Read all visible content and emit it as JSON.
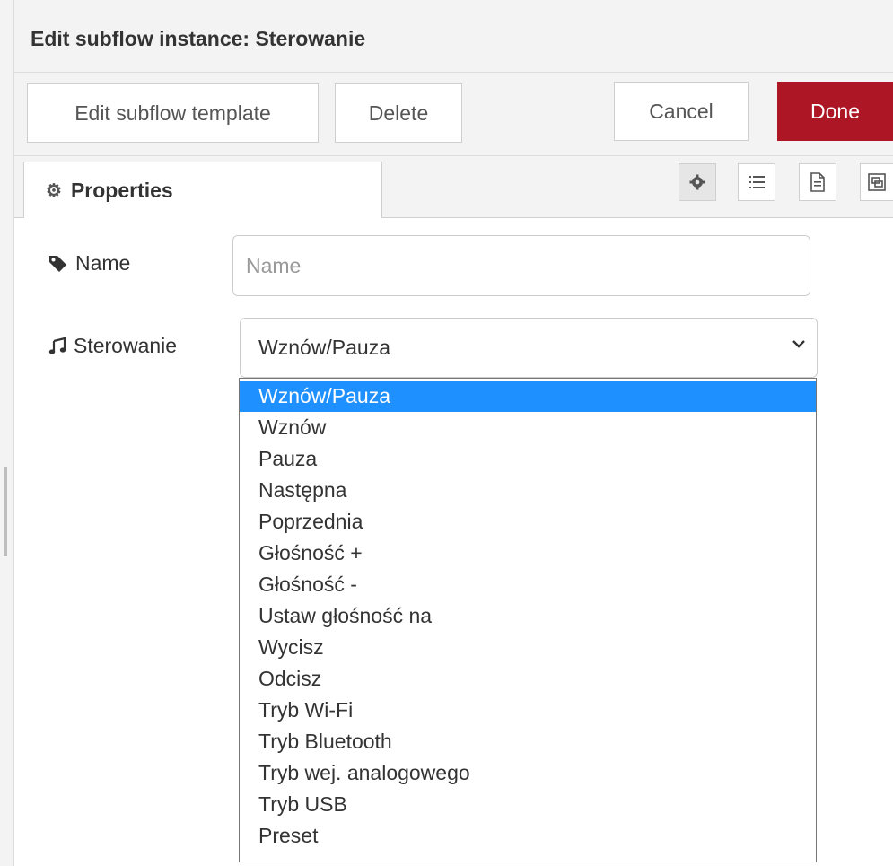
{
  "dialog": {
    "title": "Edit subflow instance: Sterowanie"
  },
  "toolbar": {
    "edit_template_label": "Edit subflow template",
    "delete_label": "Delete",
    "cancel_label": "Cancel",
    "done_label": "Done"
  },
  "tabs": {
    "properties_label": "Properties"
  },
  "form": {
    "name_label": "Name",
    "name_placeholder": "Name",
    "name_value": "",
    "control_label": "Sterowanie",
    "control_value": "Wznów/Pauza"
  },
  "dropdown": {
    "options": [
      "Wznów/Pauza",
      "Wznów",
      "Pauza",
      "Następna",
      "Poprzednia",
      "Głośność +",
      "Głośność -",
      "Ustaw głośność na",
      "Wycisz",
      "Odcisz",
      "Tryb Wi-Fi",
      "Tryb Bluetooth",
      "Tryb wej. analogowego",
      "Tryb USB",
      "Preset"
    ],
    "selected_index": 0
  },
  "icons": {
    "properties_tab": "gear-icon",
    "description_tab": "list-icon",
    "documentation_tab": "file-icon",
    "appearance_tab": "object-group-icon",
    "name_field": "tag-icon",
    "control_field": "music-icon"
  },
  "colors": {
    "done_button": "#ad1625",
    "selected_option": "#1e90ff"
  }
}
